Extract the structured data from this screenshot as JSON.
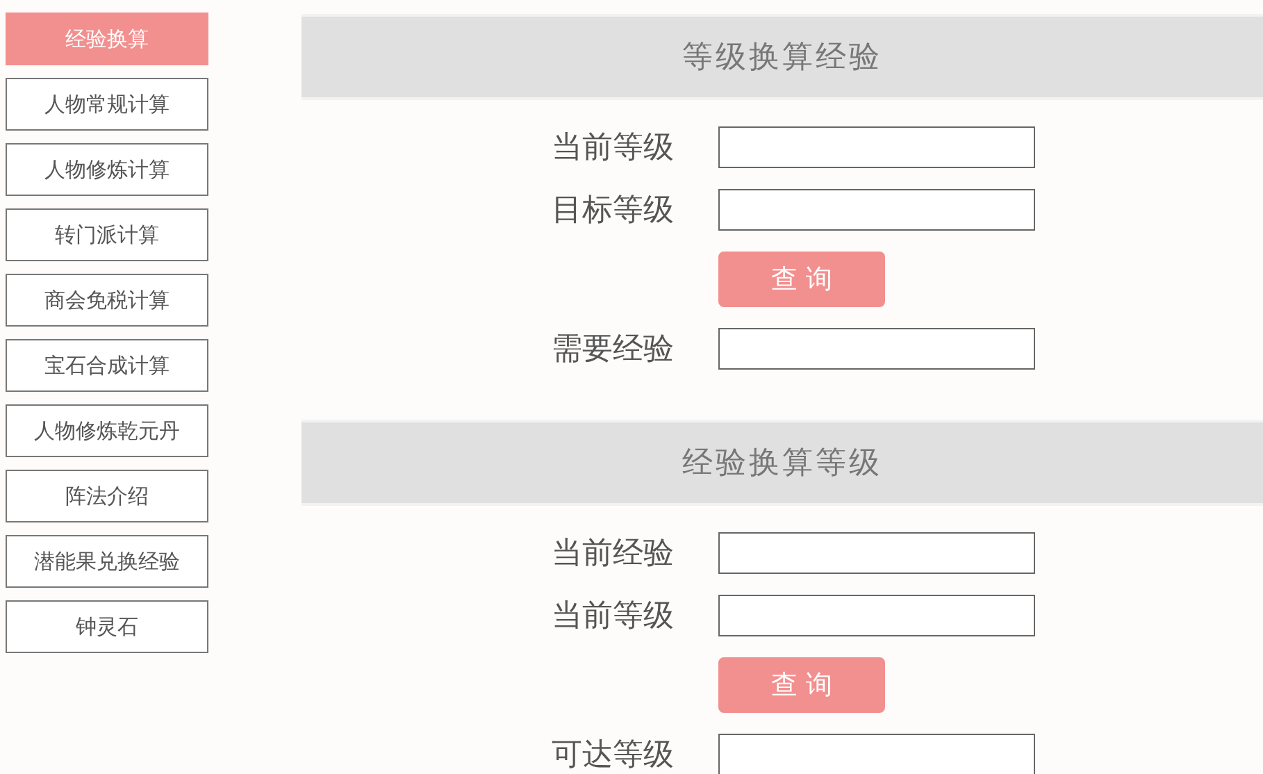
{
  "sidebar": {
    "items": [
      {
        "label": "经验换算",
        "selected": true
      },
      {
        "label": "人物常规计算",
        "selected": false
      },
      {
        "label": "人物修炼计算",
        "selected": false
      },
      {
        "label": "转门派计算",
        "selected": false
      },
      {
        "label": "商会免税计算",
        "selected": false
      },
      {
        "label": "宝石合成计算",
        "selected": false
      },
      {
        "label": "人物修炼乾元丹",
        "selected": false
      },
      {
        "label": "阵法介绍",
        "selected": false
      },
      {
        "label": "潜能果兑换经验",
        "selected": false
      },
      {
        "label": "钟灵石",
        "selected": false
      }
    ]
  },
  "sections": [
    {
      "title": "等级换算经验",
      "rows": [
        {
          "kind": "field",
          "label": "当前等级"
        },
        {
          "kind": "field",
          "label": "目标等级"
        },
        {
          "kind": "button",
          "label": "查 询"
        },
        {
          "kind": "field",
          "label": "需要经验"
        }
      ]
    },
    {
      "title": "经验换算等级",
      "rows": [
        {
          "kind": "field",
          "label": "当前经验"
        },
        {
          "kind": "field",
          "label": "当前等级"
        },
        {
          "kind": "button",
          "label": "查 询"
        },
        {
          "kind": "field",
          "label": "可达等级"
        }
      ]
    }
  ]
}
